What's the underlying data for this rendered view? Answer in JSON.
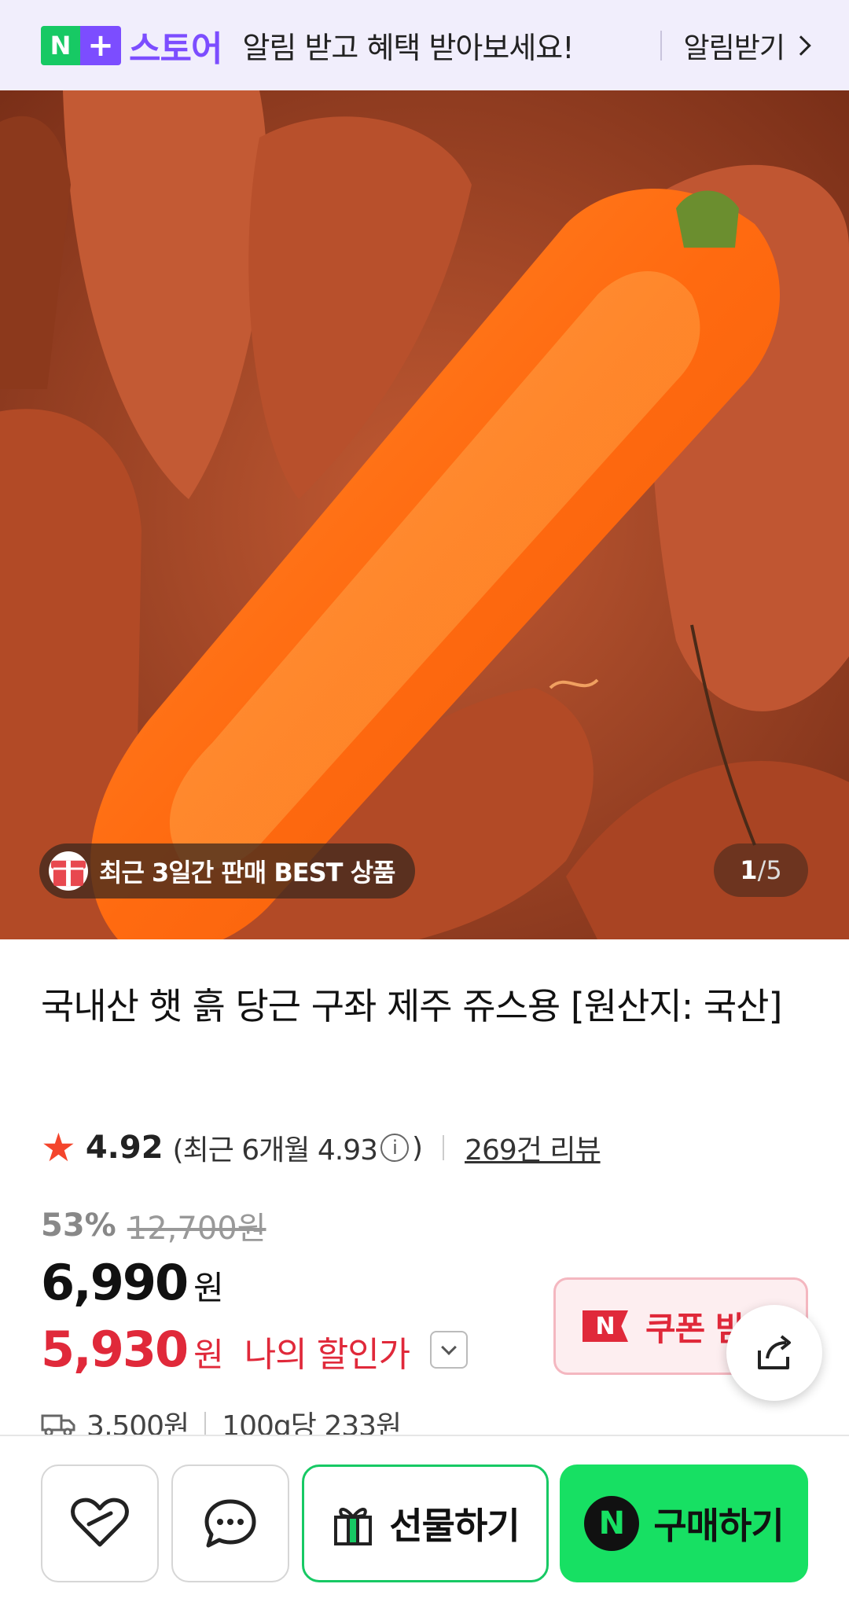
{
  "banner": {
    "logo_n": "N",
    "logo_plus": "+",
    "logo_store": "스토어",
    "message": "알림 받고 혜택 받아보세요!",
    "cta": "알림받기",
    "icons": [
      "chevron-right-icon"
    ]
  },
  "gallery": {
    "best_badge": "최근 3일간 판매 BEST 상품",
    "current_index": "1",
    "separator": "/",
    "total": "5",
    "icons": [
      "gift-box-icon"
    ]
  },
  "product": {
    "title": "국내산 햇 흙 당근 구좌 제주 쥬스용 [원산지: 국산]"
  },
  "rating": {
    "star": "★",
    "score": "4.92",
    "recent_prefix": "(최근 6개월 4.93",
    "recent_suffix": ")",
    "info_symbol": "i",
    "reviews": "269건 리뷰"
  },
  "price": {
    "discount_rate": "53%",
    "original": "12,700원",
    "sale": "6,990",
    "sale_unit": "원",
    "my_price": "5,930",
    "my_unit": "원",
    "my_label": "나의 할인가"
  },
  "coupon": {
    "mark": "N",
    "label": "쿠폰 받기"
  },
  "shipping": {
    "fee": "3,500원",
    "unit_price": "100g당 233원"
  },
  "bottom_bar": {
    "gift_label": "선물하기",
    "buy_mark": "N",
    "buy_label": "구매하기",
    "icons": [
      "heart-icon",
      "chat-bubble-icon",
      "gift-icon",
      "share-icon"
    ]
  },
  "colors": {
    "naver_green": "#17e063",
    "store_purple": "#7c4dff",
    "sale_red": "#e0293a",
    "banner_bg": "#f1eefc"
  }
}
